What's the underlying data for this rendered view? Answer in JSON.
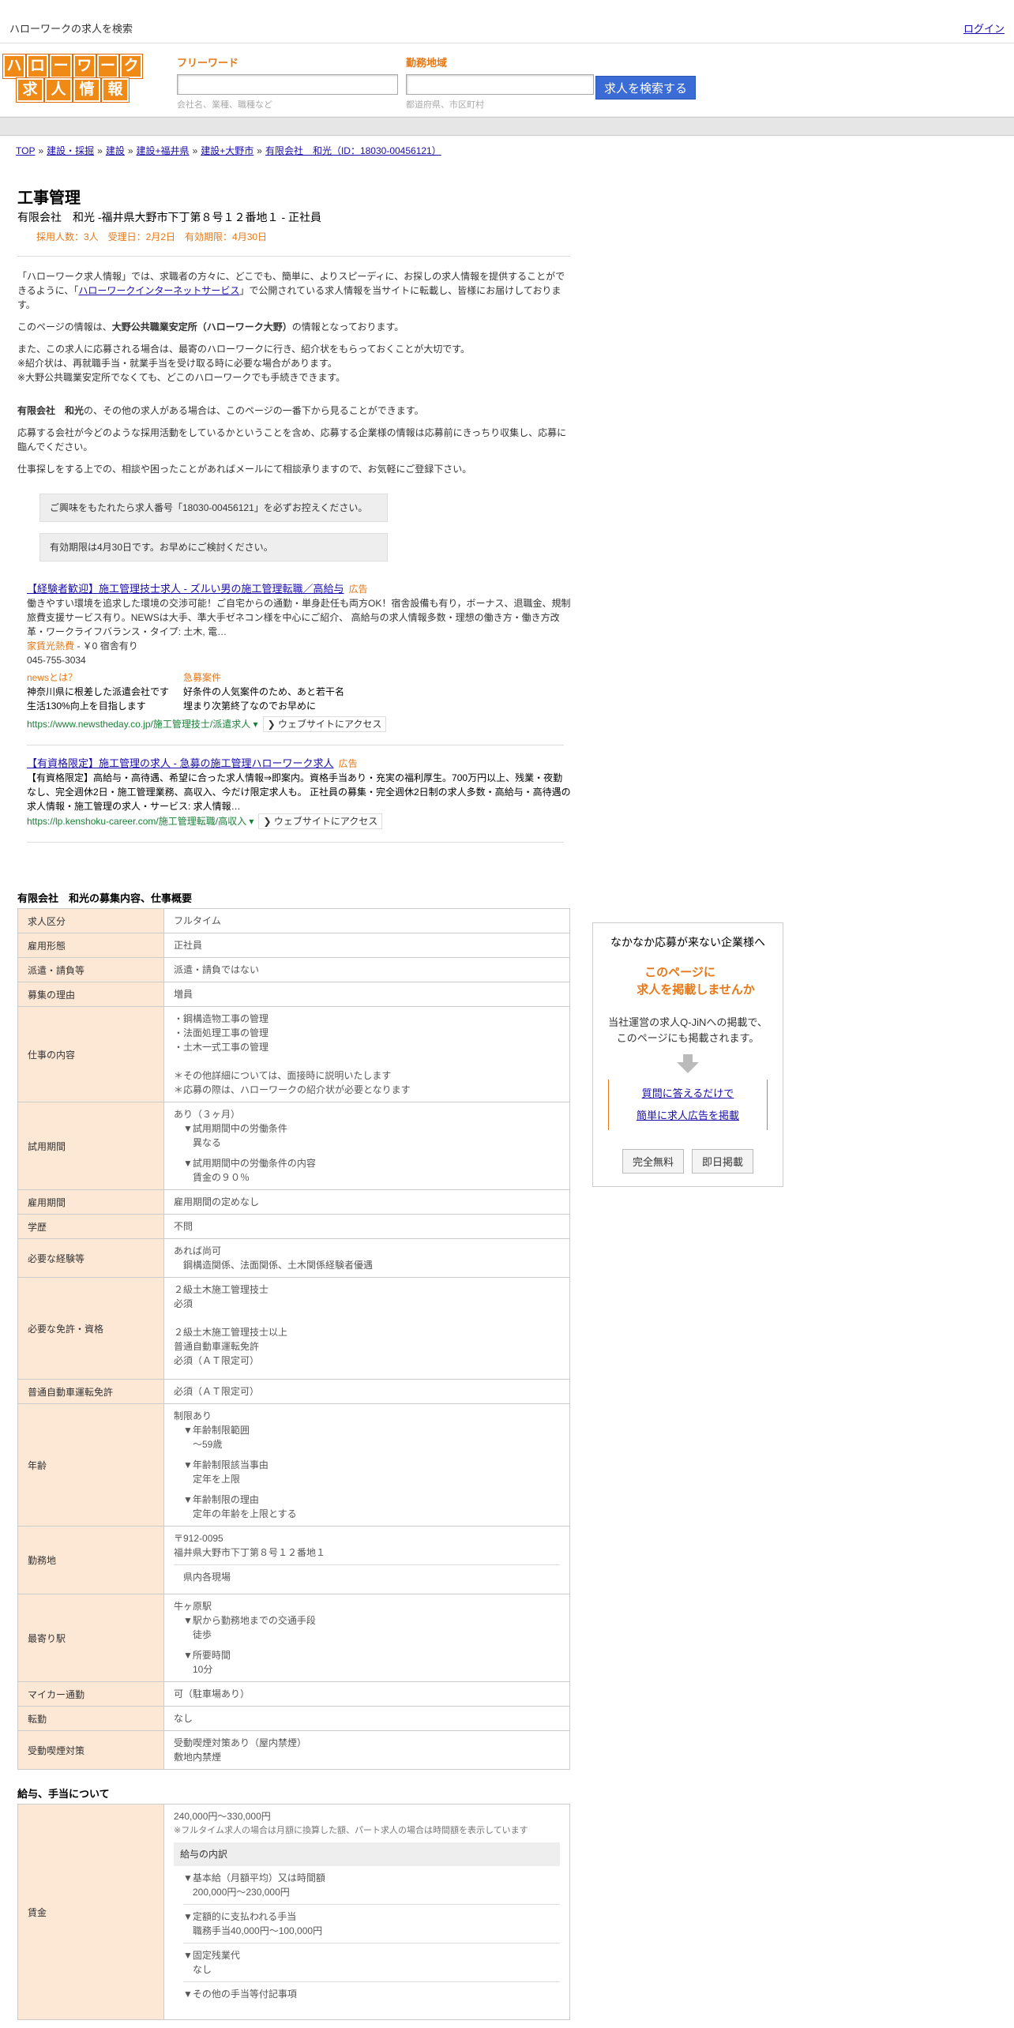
{
  "header": {
    "site_title": "ハローワークの求人を検索",
    "login": "ログイン"
  },
  "logo": {
    "row1": [
      "ハ",
      "ロ",
      "ー",
      "ワ",
      "ー",
      "ク"
    ],
    "row2": [
      "求",
      "人",
      "情",
      "報"
    ]
  },
  "search": {
    "freeword_label": "フリーワード",
    "freeword_hint": "会社名、業種、職種など",
    "area_label": "勤務地域",
    "area_hint": "都道府県、市区町村",
    "button": "求人を検索する"
  },
  "breadcrumb": [
    "TOP",
    "建設・採掘",
    "建設",
    "建設+福井県",
    "建設+大野市",
    "有限会社　和光（ID：18030-00456121）"
  ],
  "job": {
    "title": "工事管理",
    "company_line": "有限会社　和光 -福井県大野市下丁第８号１２番地１ - 正社員",
    "meta": "採用人数：3人　受理日：2月2日　有効期限：4月30日"
  },
  "intro": {
    "p1a": "「ハローワーク求人情報」では、求職者の方々に、どこでも、簡単に、よりスピーディに、お探しの求人情報を提供することができるように、「",
    "p1link": "ハローワークインターネットサービス",
    "p1b": "」で公開されている求人情報を当サイトに転載し、皆様にお届けしております。",
    "p2a": "このページの情報は、",
    "p2b": "大野公共職業安定所（ハローワーク大野）",
    "p2c": "の情報となっております。",
    "p3": "また、この求人に応募される場合は、最寄のハローワークに行き、紹介状をもらっておくことが大切です。",
    "p4": "※紹介状は、再就職手当・就業手当を受け取る時に必要な場合があります。",
    "p5": "※大野公共職業安定所でなくても、どこのハローワークでも手続きできます。",
    "p6a": "有限会社　和光",
    "p6b": "の、その他の求人がある場合は、このページの一番下から見ることができます。",
    "p7": "応募する会社が今どのような採用活動をしているかということを含め、応募する企業様の情報は応募前にきっちり収集し、応募に臨んでください。",
    "p8": "仕事探しをする上での、相談や困ったことがあればメールにて相談承りますので、お気軽にご登録下さい。",
    "box1": "ご興味をもたれたら求人番号「18030-00456121」を必ずお控えください。",
    "box2": "有効期限は4月30日です。お早めにご検討ください。"
  },
  "ads": [
    {
      "title": "【経験者歓迎】施工管理技士求人 - ズルい男の施工管理転職／高給与",
      "tag": "広告",
      "desc": "働きやすい環境を追求した環境の交渉可能！ご自宅からの通勤・単身赴任も両方OK！宿舎設備も有り，ボーナス、退職金、規制旅費支援サービス有り。NEWSは大手、準大手ゼネコン様を中心にご紹介、 高給与の求人情報多数・理想の働き方・働き方改革・ワークライフバランス・タイプ: 土木, 電…",
      "rent_label": "家賃光熱費",
      "rent_value": " - ￥0 宿舎有り",
      "phone": "045-755-3034",
      "col1_head": "newsとは？",
      "col1_l1": "神奈川県に根差した派遣会社です",
      "col1_l2": "生活130%向上を目指します",
      "col2_head": "急募案件",
      "col2_l1": "好条件の人気案件のため、あと若干名",
      "col2_l2": "埋まり次第終了なのでお早めに",
      "url": "https://www.newstheday.co.jp/施工管理技士/派遣求人",
      "visit": "❯ ウェブサイトにアクセス"
    },
    {
      "title": "【有資格限定】施工管理の求人 - 急募の施工管理ハローワーク求人",
      "tag": "広告",
      "desc": "【有資格限定】高給与・高待遇、希望に合った求人情報⇒即案内。資格手当あり・充実の福利厚生。700万円以上、残業・夜勤なし、完全週休2日・施工管理業務、高収入、今だけ限定求人も。 正社員の募集・完全週休2日制の求人多数・高給与・高待遇の求人情報・施工管理の求人・サービス: 求人情報…",
      "url": "https://lp.kenshoku-career.com/施工管理転職/高収入",
      "visit": "❯ ウェブサイトにアクセス"
    }
  ],
  "details": {
    "title": "有限会社　和光の募集内容、仕事概要",
    "rows": {
      "kubun": {
        "h": "求人区分",
        "v": "フルタイム"
      },
      "keitai": {
        "h": "雇用形態",
        "v": "正社員"
      },
      "haken": {
        "h": "派遣・請負等",
        "v": "派遣・請負ではない"
      },
      "riyu": {
        "h": "募集の理由",
        "v": "増員"
      },
      "naiyo": {
        "h": "仕事の内容",
        "l1": "・鋼構造物工事の管理",
        "l2": "・法面処理工事の管理",
        "l3": "・土木一式工事の管理",
        "l4": "＊その他詳細については、面接時に説明いたします",
        "l5": "＊応募の際は、ハローワークの紹介状が必要となります"
      },
      "shiyo": {
        "h": "試用期間",
        "l1": "あり（３ヶ月）",
        "l2": "▼試用期間中の労働条件",
        "l3": "異なる",
        "l4": "▼試用期間中の労働条件の内容",
        "l5": "賃金の９０％"
      },
      "kikan": {
        "h": "雇用期間",
        "v": "雇用期間の定めなし"
      },
      "gakureki": {
        "h": "学歴",
        "v": "不問"
      },
      "keiken": {
        "h": "必要な経験等",
        "l1": "あれば尚可",
        "l2": "鋼構造関係、法面関係、土木関係経験者優遇"
      },
      "menkyo": {
        "h": "必要な免許・資格",
        "l1": "２級土木施工管理技士",
        "l2": "必須",
        "l3": "２級土木施工管理技士以上",
        "l4": "普通自動車運転免許",
        "l5": "必須（ＡＴ限定可）"
      },
      "futsu": {
        "h": "普通自動車運転免許",
        "v": "必須（ＡＴ限定可）"
      },
      "nenrei": {
        "h": "年齢",
        "l1": "制限あり",
        "l2": "▼年齢制限範囲",
        "l3": "〜59歳",
        "l4": "▼年齢制限該当事由",
        "l5": "定年を上限",
        "l6": "▼年齢制限の理由",
        "l7": "定年の年齢を上限とする"
      },
      "kinmuchi": {
        "h": "勤務地",
        "l1": "〒912-0095",
        "l2": "福井県大野市下丁第８号１２番地１",
        "l3": "県内各現場"
      },
      "eki": {
        "h": "最寄り駅",
        "l1": "牛ヶ原駅",
        "l2": "▼駅から勤務地までの交通手段",
        "l3": "徒歩",
        "l4": "▼所要時間",
        "l5": "10分"
      },
      "mycar": {
        "h": "マイカー通勤",
        "v": "可（駐車場あり）"
      },
      "tenkin": {
        "h": "転勤",
        "v": "なし"
      },
      "kitsuen": {
        "h": "受動喫煙対策",
        "l1": "受動喫煙対策あり（屋内禁煙）",
        "l2": "敷地内禁煙"
      }
    }
  },
  "salary": {
    "title": "給与、手当について",
    "h": "賃金",
    "range": "240,000円〜330,000円",
    "note": "※フルタイム求人の場合は月額に換算した額、パート求人の場合は時間額を表示しています",
    "inner_head": "給与の内訳",
    "l1": "▼基本給（月額平均）又は時間額",
    "l2": "200,000円〜230,000円",
    "l3": "▼定額的に支払われる手当",
    "l4": "職務手当40,000円〜100,000円",
    "l5": "▼固定残業代",
    "l6": "なし",
    "l7": "▼その他の手当等付記事項"
  },
  "side": {
    "title": "なかなか応募が来ない企業様へ",
    "catch1": "このページに",
    "catch2": "求人を掲載しませんか",
    "desc1": "当社運営の求人Q-JiNへの掲載で、",
    "desc2": "このページにも掲載されます。",
    "link1": "質問に答えるだけで",
    "link2": "簡単に求人広告を掲載",
    "btn1": "完全無料",
    "btn2": "即日掲載"
  },
  "colors": {
    "accent": "#e67817",
    "th_bg": "#fde8d6",
    "button": "#3b6cd6",
    "link": "#1a0dab"
  }
}
